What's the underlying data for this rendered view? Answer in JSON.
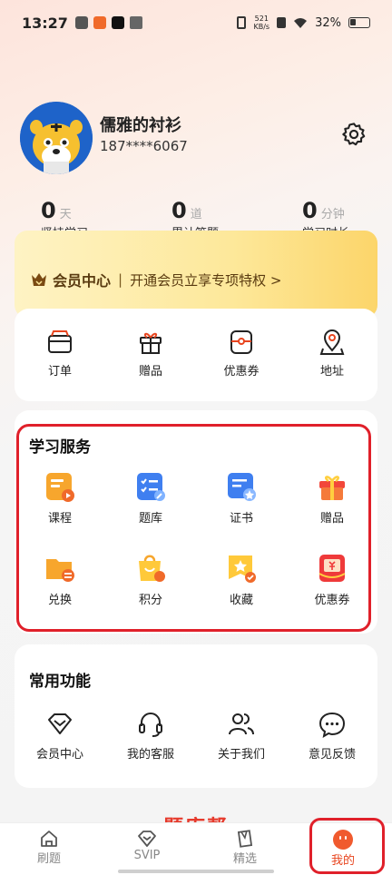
{
  "status_bar": {
    "time": "13:27",
    "net_speed": "521",
    "net_unit": "KB/s",
    "battery": "32%",
    "battery_level": 0.32
  },
  "profile": {
    "name": "儒雅的衬衫",
    "phone": "187****6067"
  },
  "stats": [
    {
      "value": "0",
      "unit": "天",
      "label": "坚持学习"
    },
    {
      "value": "0",
      "unit": "道",
      "label": "累计答题"
    },
    {
      "value": "0",
      "unit": "分钟",
      "label": "学习时长"
    }
  ],
  "vip": {
    "title": "会员中心",
    "separator": "|",
    "promo": "开通会员立享专项特权 >"
  },
  "orders": [
    {
      "label": "订单",
      "icon": "wallet-icon"
    },
    {
      "label": "赠品",
      "icon": "gift-icon"
    },
    {
      "label": "优惠券",
      "icon": "coupon-icon"
    },
    {
      "label": "地址",
      "icon": "location-icon"
    }
  ],
  "study_services": {
    "title": "学习服务",
    "items": [
      {
        "label": "课程",
        "icon": "course-icon"
      },
      {
        "label": "题库",
        "icon": "question-bank-icon"
      },
      {
        "label": "证书",
        "icon": "certificate-icon"
      },
      {
        "label": "赠品",
        "icon": "gift-box-icon"
      },
      {
        "label": "兑换",
        "icon": "exchange-icon"
      },
      {
        "label": "积分",
        "icon": "points-icon"
      },
      {
        "label": "收藏",
        "icon": "favorites-icon"
      },
      {
        "label": "优惠券",
        "icon": "red-coupon-icon"
      }
    ]
  },
  "common_functions": {
    "title": "常用功能",
    "items": [
      {
        "label": "会员中心",
        "icon": "diamond-icon"
      },
      {
        "label": "我的客服",
        "icon": "headset-icon"
      },
      {
        "label": "关于我们",
        "icon": "users-icon"
      },
      {
        "label": "意见反馈",
        "icon": "chat-bubble-icon"
      }
    ]
  },
  "brand_partial": "题库帮",
  "tabs": [
    {
      "label": "刷题",
      "icon": "home-icon"
    },
    {
      "label": "SVIP",
      "icon": "diamond-icon"
    },
    {
      "label": "精选",
      "icon": "bookmark-icon"
    },
    {
      "label": "我的",
      "icon": "face-icon"
    }
  ],
  "colors": {
    "accent": "#e8451f",
    "highlight": "#e0202a",
    "vip_gold": "#fcd56a"
  }
}
